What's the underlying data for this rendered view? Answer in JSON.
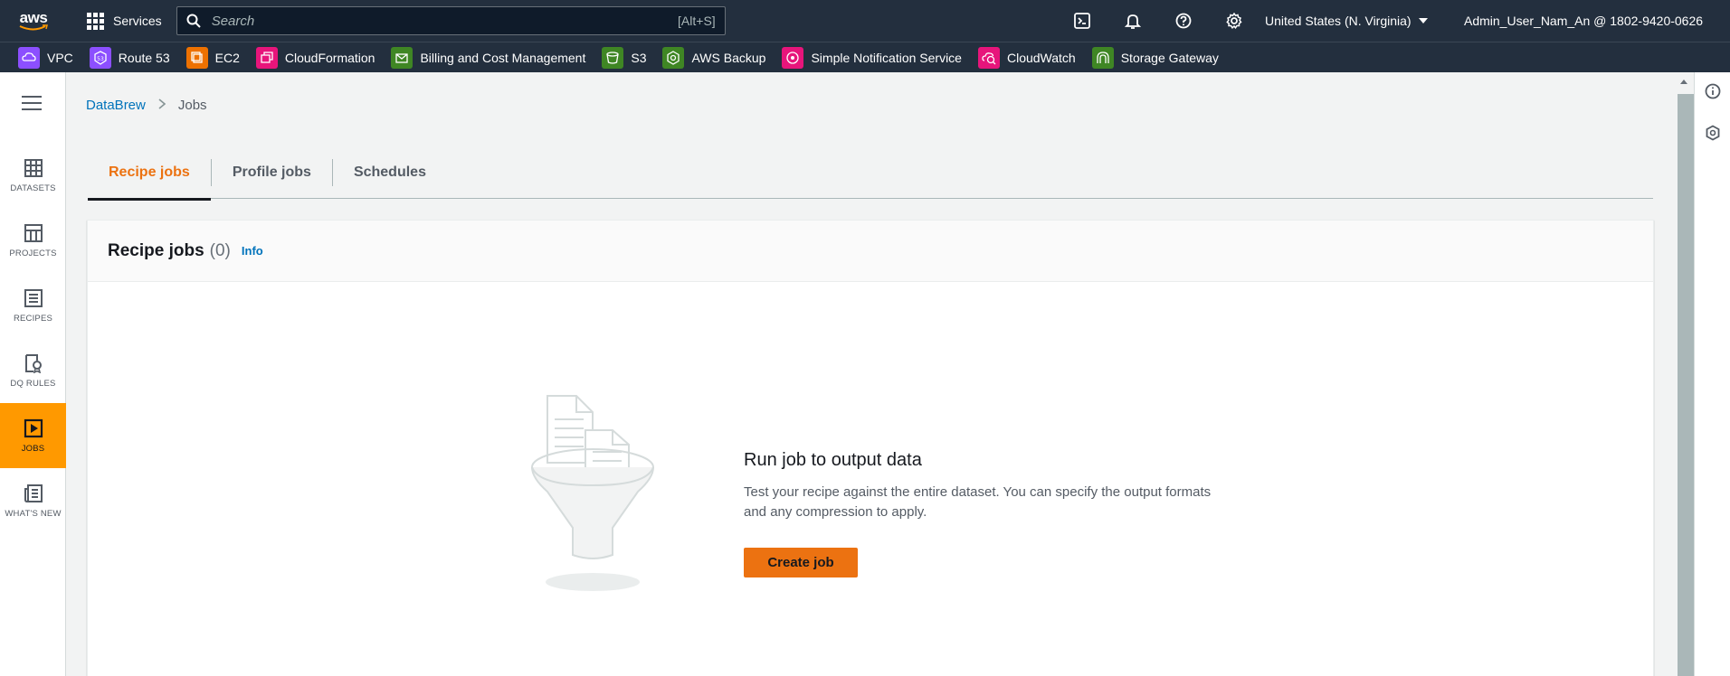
{
  "topnav": {
    "logo_text": "aws",
    "services_label": "Services",
    "search_placeholder": "Search",
    "search_shortcut": "[Alt+S]",
    "region": "United States (N. Virginia)",
    "account": "Admin_User_Nam_An @ 1802-9420-0626"
  },
  "favorites": [
    {
      "label": "VPC",
      "color": "#8c4fff"
    },
    {
      "label": "Route 53",
      "color": "#8c4fff"
    },
    {
      "label": "EC2",
      "color": "#ed7100"
    },
    {
      "label": "CloudFormation",
      "color": "#e7157b"
    },
    {
      "label": "Billing and Cost Management",
      "color": "#3f8624"
    },
    {
      "label": "S3",
      "color": "#3f8624"
    },
    {
      "label": "AWS Backup",
      "color": "#3f8624"
    },
    {
      "label": "Simple Notification Service",
      "color": "#e7157b"
    },
    {
      "label": "CloudWatch",
      "color": "#e7157b"
    },
    {
      "label": "Storage Gateway",
      "color": "#3f8624"
    }
  ],
  "rail": {
    "items": [
      {
        "label": "DATASETS"
      },
      {
        "label": "PROJECTS"
      },
      {
        "label": "RECIPES"
      },
      {
        "label": "DQ RULES"
      },
      {
        "label": "JOBS",
        "active": true
      },
      {
        "label": "WHAT'S NEW"
      }
    ]
  },
  "breadcrumb": {
    "root": "DataBrew",
    "current": "Jobs"
  },
  "tabs": [
    {
      "label": "Recipe jobs",
      "active": true
    },
    {
      "label": "Profile jobs"
    },
    {
      "label": "Schedules"
    }
  ],
  "card": {
    "title": "Recipe jobs",
    "count": "(0)",
    "info": "Info"
  },
  "empty_state": {
    "title": "Run job to output data",
    "description": "Test your recipe against the entire dataset. You can specify the output formats and any compression to apply.",
    "button": "Create job"
  },
  "colors": {
    "nav_bg": "#232f3e",
    "accent": "#ff9900",
    "link": "#0073bb",
    "active_tab": "#ec7211"
  }
}
